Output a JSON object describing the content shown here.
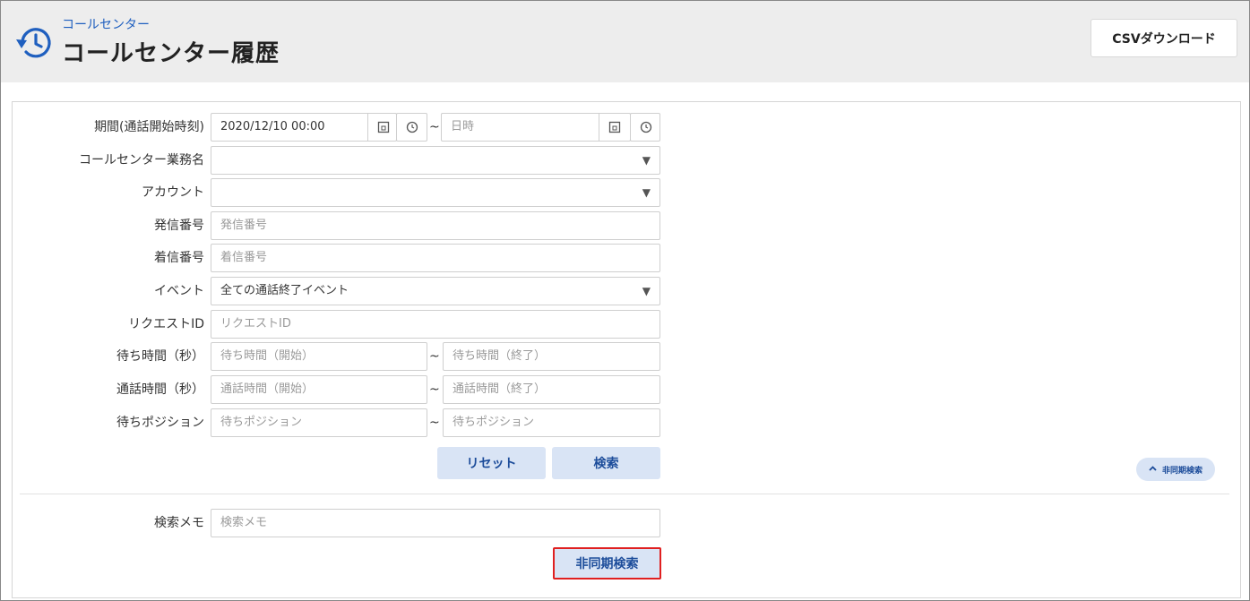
{
  "header": {
    "subtitle": "コールセンター",
    "title": "コールセンター履歴",
    "csv_button": "CSVダウンロード"
  },
  "form": {
    "period": {
      "label": "期間(通話開始時刻)",
      "start_value": "2020/12/10 00:00",
      "end_placeholder": "日時",
      "separator": "~"
    },
    "business": {
      "label": "コールセンター業務名",
      "value": ""
    },
    "account": {
      "label": "アカウント",
      "value": ""
    },
    "caller": {
      "label": "発信番号",
      "placeholder": "発信番号"
    },
    "callee": {
      "label": "着信番号",
      "placeholder": "着信番号"
    },
    "event": {
      "label": "イベント",
      "value": "全ての通話終了イベント"
    },
    "request_id": {
      "label": "リクエストID",
      "placeholder": "リクエストID"
    },
    "wait_time": {
      "label": "待ち時間（秒）",
      "start_placeholder": "待ち時間（開始）",
      "end_placeholder": "待ち時間（終了）",
      "separator": "~"
    },
    "talk_time": {
      "label": "通話時間（秒）",
      "start_placeholder": "通話時間（開始）",
      "end_placeholder": "通話時間（終了）",
      "separator": "~"
    },
    "wait_position": {
      "label": "待ちポジション",
      "start_placeholder": "待ちポジション",
      "end_placeholder": "待ちポジション",
      "separator": "~"
    },
    "reset_button": "リセット",
    "search_button": "検索"
  },
  "async": {
    "toggle_label": "非同期検索",
    "memo_label": "検索メモ",
    "memo_placeholder": "検索メモ",
    "button": "非同期検索"
  },
  "colors": {
    "accent": "#1f5fbf",
    "button_bg": "#d9e4f5",
    "highlight_border": "#e02020"
  }
}
